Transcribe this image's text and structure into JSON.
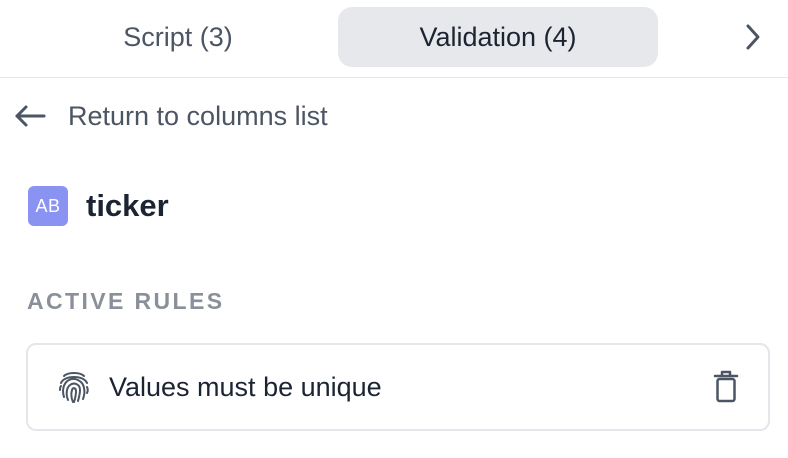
{
  "tabs": [
    {
      "label": "Script (3)",
      "active": false
    },
    {
      "label": "Validation (4)",
      "active": true
    }
  ],
  "tabs_next_icon": "chevron-right-icon",
  "back": {
    "icon": "arrow-left-icon",
    "label": "Return to columns list"
  },
  "column": {
    "type_badge": "AB",
    "name": "ticker"
  },
  "section": {
    "title": "ACTIVE RULES"
  },
  "rules": [
    {
      "icon": "fingerprint-icon",
      "label": "Values must be unique",
      "action_icon": "trash-icon"
    }
  ],
  "colors": {
    "active_tab_bg": "#e6e8ec",
    "badge_bg": "#8b93f2",
    "text_primary": "#1c2433",
    "text_secondary": "#4b5563",
    "section_title": "#8a9099",
    "border": "#e3e6eb"
  }
}
